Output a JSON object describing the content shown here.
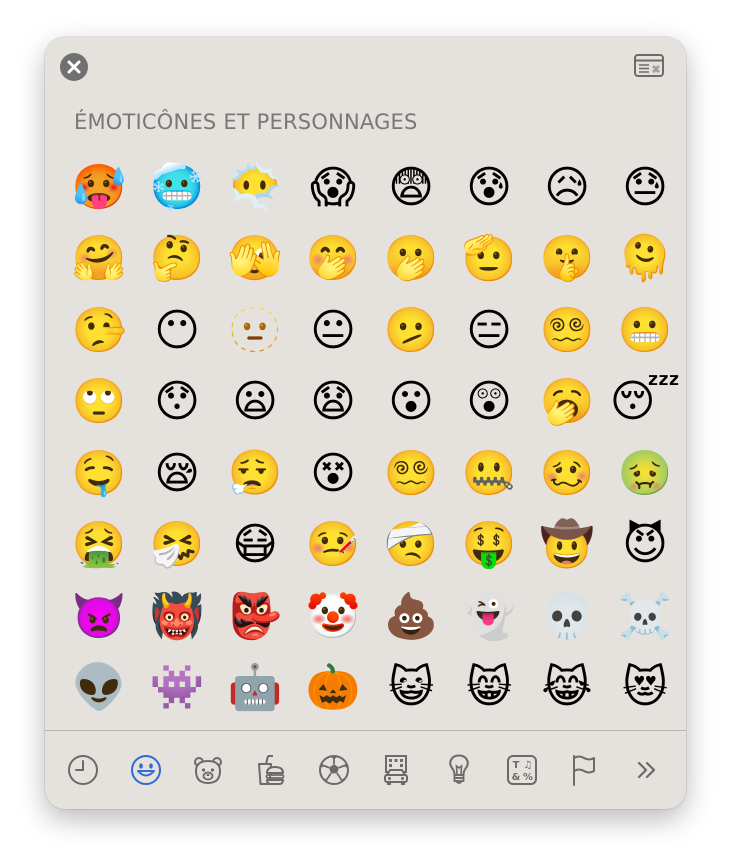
{
  "window": {
    "close_label": "×",
    "keyboard_viewer_label": "⌘"
  },
  "section_title": "ÉMOTICÔNES ET PERSONNAGES",
  "emojis": [
    "🥵",
    "🥶",
    "😶‍🌫️",
    "😱",
    "😨",
    "😰",
    "😥",
    "😓",
    "🤗",
    "🤔",
    "🫣",
    "🤭",
    "🫢",
    "🫡",
    "🤫",
    "🫠",
    "🤥",
    "😶",
    "🫥",
    "😐",
    "🫤",
    "😑",
    "😵‍💫",
    "😬",
    "🙄",
    "😯",
    "😦",
    "😧",
    "😮",
    "😲",
    "🥱",
    "😴",
    "🤤",
    "😪",
    "😮‍💨",
    "😵",
    "😵‍💫",
    "🤐",
    "🥴",
    "🤢",
    "🤮",
    "🤧",
    "😷",
    "🤒",
    "🤕",
    "🤑",
    "🤠",
    "😈",
    "👿",
    "👹",
    "👺",
    "🤡",
    "💩",
    "👻",
    "💀",
    "☠️",
    "👽",
    "👾",
    "🤖",
    "🎃",
    "😺",
    "😸",
    "😹",
    "😻"
  ],
  "categories": [
    {
      "id": "recent",
      "icon": "clock-icon",
      "selected": false
    },
    {
      "id": "smileys",
      "icon": "smiley-icon",
      "selected": true
    },
    {
      "id": "animals",
      "icon": "bear-icon",
      "selected": false
    },
    {
      "id": "food",
      "icon": "burger-drink-icon",
      "selected": false
    },
    {
      "id": "activity",
      "icon": "soccer-ball-icon",
      "selected": false
    },
    {
      "id": "travel",
      "icon": "buildings-car-icon",
      "selected": false
    },
    {
      "id": "objects",
      "icon": "lightbulb-icon",
      "selected": false
    },
    {
      "id": "symbols",
      "icon": "symbols-icon",
      "selected": false
    },
    {
      "id": "flags",
      "icon": "flag-icon",
      "selected": false
    },
    {
      "id": "more",
      "icon": "double-chevron-right-icon",
      "selected": false
    }
  ],
  "colors": {
    "panel_bg": "#e5e1dd",
    "icon_gray": "#6e6a68",
    "selected_blue": "#2f6ad8",
    "title_gray": "#7b7775"
  }
}
